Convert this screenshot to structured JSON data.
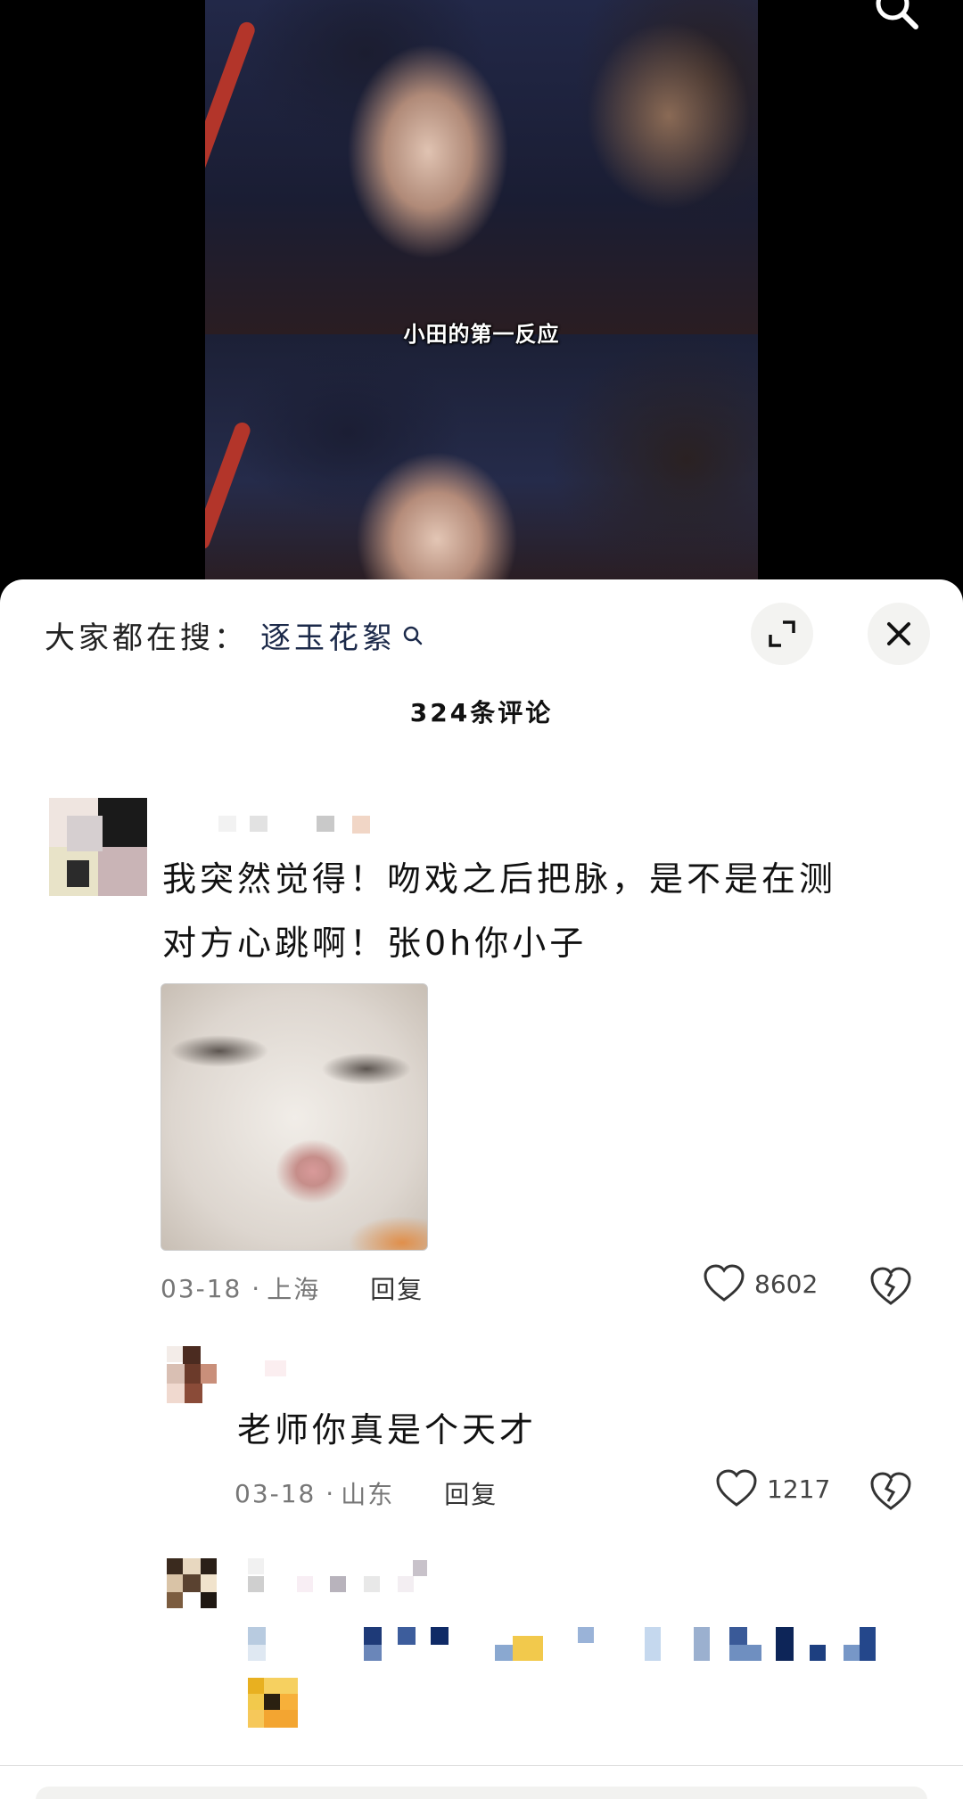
{
  "video": {
    "subtitle": "小田的第一反应"
  },
  "sheet": {
    "hot_search_prefix": "大家都在搜：",
    "hot_search_term": "逐玉花絮",
    "comment_count_title": "324条评论"
  },
  "comments": [
    {
      "text_line1": "我突然觉得！吻戏之后把脉，是不是在测",
      "text_line2": "对方心跳啊！张0h你小子",
      "date": "03-18",
      "location": "上海",
      "reply_label": "回复",
      "likes": "8602",
      "has_image": true
    },
    {
      "text_line1": "老师你真是个天才",
      "date": "03-18",
      "location": "山东",
      "reply_label": "回复",
      "likes": "1217"
    }
  ],
  "colors": {
    "sheet_bg": "#ffffff",
    "video_bg": "#000000",
    "button_bg": "#f3f3f1",
    "link": "#1c2a4a"
  },
  "icons": {
    "top_search": "search-icon",
    "expand": "expand-icon",
    "close": "close-icon",
    "like": "heart-icon",
    "dislike": "broken-heart-icon"
  }
}
